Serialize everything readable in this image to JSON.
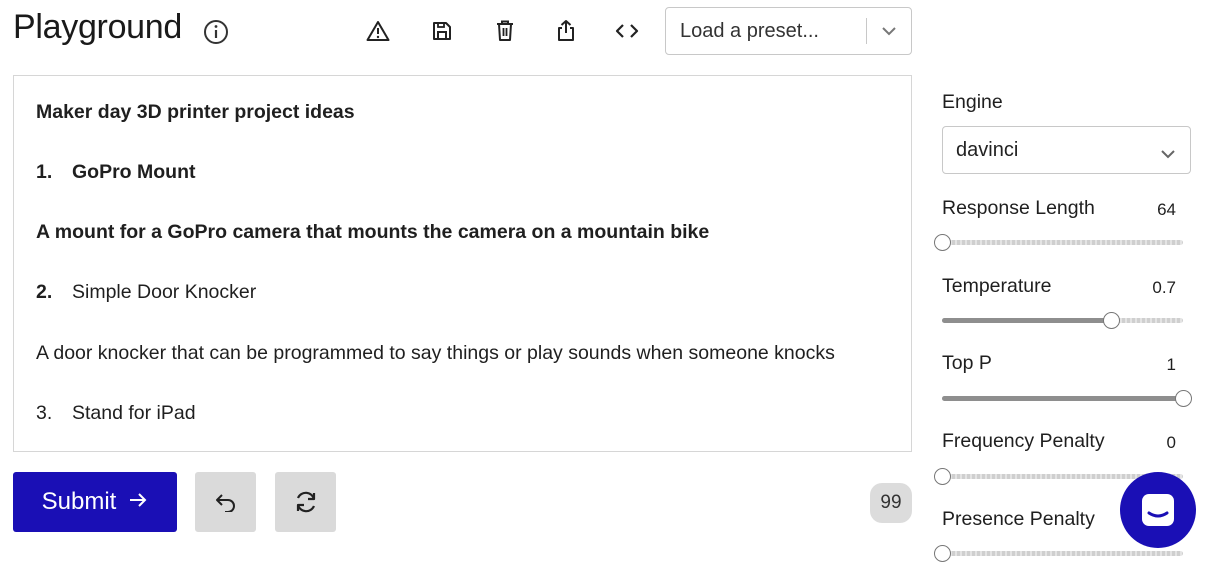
{
  "header": {
    "title": "Playground",
    "preset_placeholder": "Load a preset..."
  },
  "toolbar": {
    "icons": [
      "warning-icon",
      "save-icon",
      "trash-icon",
      "share-icon",
      "code-icon"
    ]
  },
  "editor": {
    "lines": [
      {
        "text": "Maker day 3D printer project ideas",
        "bold": true
      },
      {
        "num": "1.",
        "text": "GoPro Mount",
        "bold": true
      },
      {
        "text": "A mount for a GoPro camera that mounts the camera on a mountain bike",
        "bold": true
      },
      {
        "num": "2.",
        "text": "Simple Door Knocker",
        "bold": false,
        "num_bold": true
      },
      {
        "text": "A door knocker that can be programmed to say things or play sounds when someone knocks",
        "bold": false
      },
      {
        "num": "3.",
        "text": "Stand for iPad",
        "bold": false
      }
    ]
  },
  "actions": {
    "submit_label": "Submit",
    "token_count": "99"
  },
  "settings": {
    "engine_label": "Engine",
    "engine_value": "davinci",
    "params": [
      {
        "label": "Response Length",
        "value": "64",
        "level": 0.0
      },
      {
        "label": "Temperature",
        "value": "0.7",
        "level": 0.7
      },
      {
        "label": "Top P",
        "value": "1",
        "level": 1.0
      },
      {
        "label": "Frequency Penalty",
        "value": "0",
        "level": 0.0
      },
      {
        "label": "Presence Penalty",
        "value": "",
        "level": 0.0
      }
    ]
  },
  "colors": {
    "accent": "#1a0fb5",
    "button_gray": "#dadada"
  }
}
